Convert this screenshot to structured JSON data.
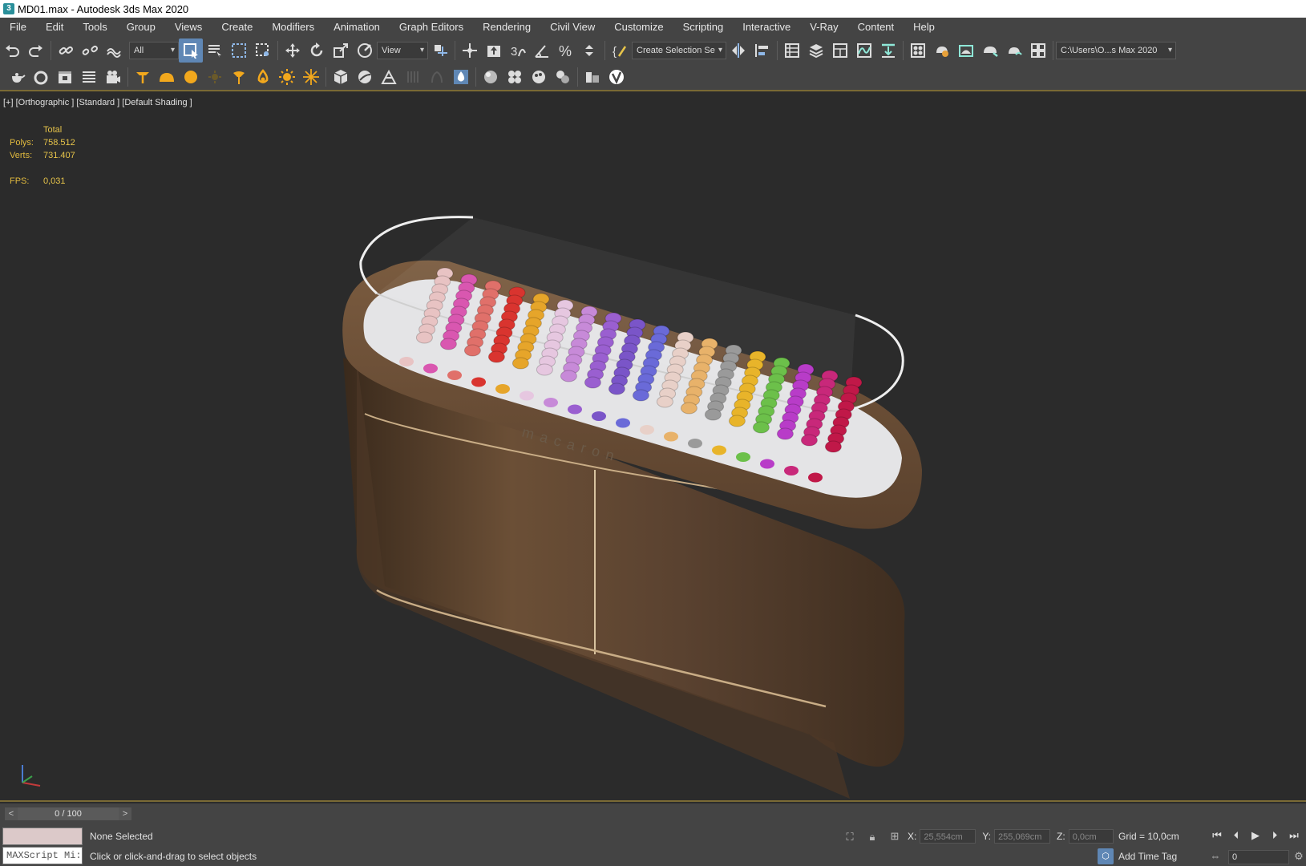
{
  "window": {
    "title": "MD01.max - Autodesk 3ds Max 2020",
    "icon": "3"
  },
  "menu": [
    "File",
    "Edit",
    "Tools",
    "Group",
    "Views",
    "Create",
    "Modifiers",
    "Animation",
    "Graph Editors",
    "Rendering",
    "Civil View",
    "Customize",
    "Scripting",
    "Interactive",
    "V-Ray",
    "Content",
    "Help"
  ],
  "toolbar": {
    "filter_dropdown": "All",
    "view_dropdown": "View",
    "selection_set_dropdown": "Create Selection Se",
    "project_path": "C:\\Users\\O...s Max 2020"
  },
  "viewport": {
    "label": "[+] [Orthographic ] [Standard ] [Default Shading ]",
    "stats": {
      "header": "Total",
      "polys_label": "Polys:",
      "polys": "758.512",
      "verts_label": "Verts:",
      "verts": "731.407",
      "fps_label": "FPS:",
      "fps": "0,031"
    },
    "scene_text": "macaron"
  },
  "timeline": {
    "prev": "<",
    "position": "0 / 100",
    "next": ">"
  },
  "status": {
    "maxscript": "MAXScript Mi:",
    "selection": "None Selected",
    "prompt": "Click or click-and-drag to select objects",
    "x_label": "X:",
    "x": "25,554cm",
    "y_label": "Y:",
    "y": "255,069cm",
    "z_label": "Z:",
    "z": "0,0cm",
    "grid": "Grid = 10,0cm",
    "add_time_tag": "Add Time Tag",
    "frame": "0"
  },
  "colors": {
    "ui_bg": "#444444",
    "viewport_bg": "#2b2b2b",
    "stats": "#e7c44a",
    "accent": "#7a6a35",
    "active_tool": "#5f87b5"
  }
}
